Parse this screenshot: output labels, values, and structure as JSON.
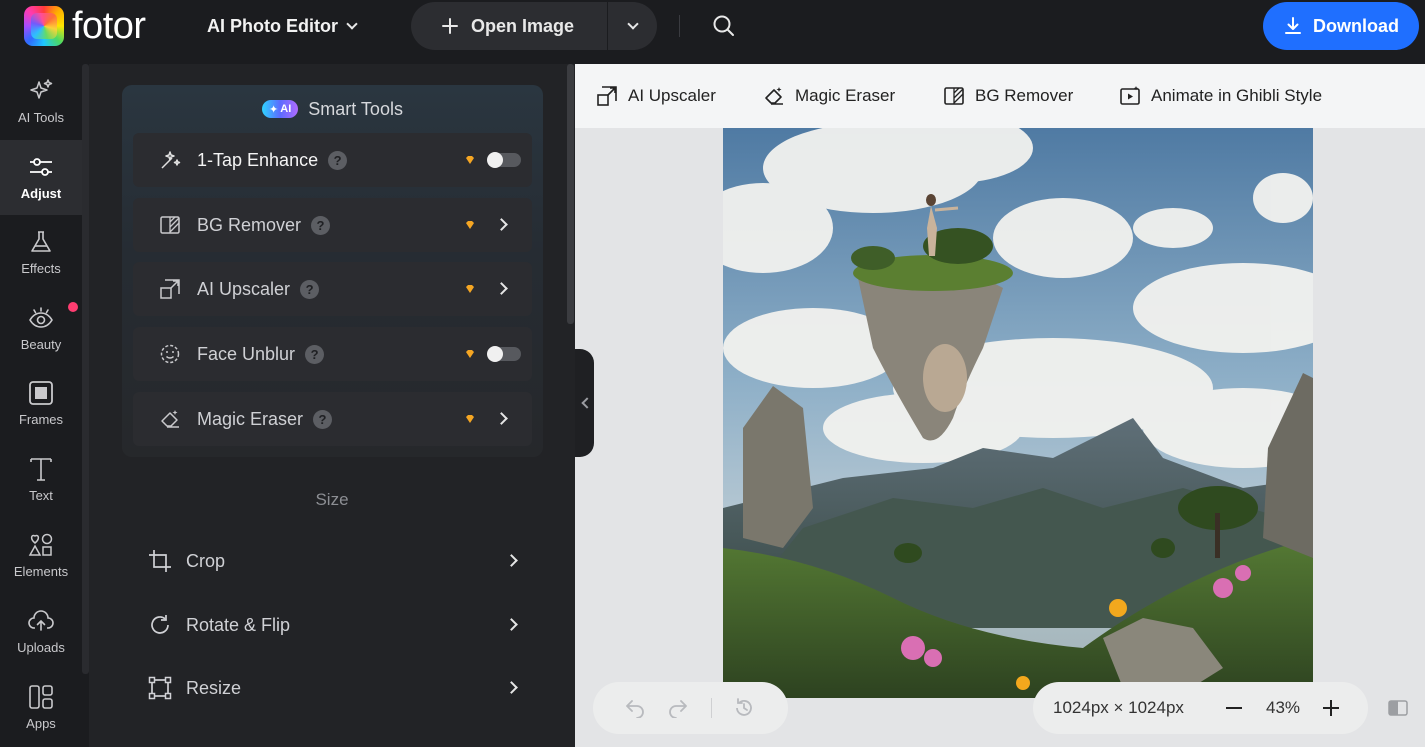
{
  "header": {
    "logo_text": "fotor",
    "editor_menu": "AI Photo Editor",
    "open_image": "Open Image",
    "download": "Download"
  },
  "rail": {
    "items": [
      {
        "label": "AI Tools",
        "icon": "sparkle-icon"
      },
      {
        "label": "Adjust",
        "icon": "sliders-icon",
        "active": true
      },
      {
        "label": "Effects",
        "icon": "flask-icon"
      },
      {
        "label": "Beauty",
        "icon": "eye-icon",
        "badge": true
      },
      {
        "label": "Frames",
        "icon": "frame-icon"
      },
      {
        "label": "Text",
        "icon": "text-icon"
      },
      {
        "label": "Elements",
        "icon": "shapes-icon"
      },
      {
        "label": "Uploads",
        "icon": "cloud-upload-icon"
      },
      {
        "label": "Apps",
        "icon": "apps-icon"
      }
    ]
  },
  "smart_tools": {
    "badge": "AI",
    "title": "Smart Tools",
    "items": [
      {
        "label": "1-Tap Enhance",
        "control": "toggle",
        "on": false
      },
      {
        "label": "BG Remover",
        "control": "arrow"
      },
      {
        "label": "AI Upscaler",
        "control": "arrow"
      },
      {
        "label": "Face Unblur",
        "control": "toggle",
        "on": false
      },
      {
        "label": "Magic Eraser",
        "control": "arrow"
      }
    ]
  },
  "size_section": {
    "title": "Size",
    "items": [
      {
        "label": "Crop"
      },
      {
        "label": "Rotate & Flip"
      },
      {
        "label": "Resize"
      }
    ]
  },
  "canvas_toolbar": {
    "items": [
      {
        "label": "AI Upscaler",
        "icon": "upscale-icon"
      },
      {
        "label": "Magic Eraser",
        "icon": "eraser-icon"
      },
      {
        "label": "BG Remover",
        "icon": "bg-remove-icon"
      },
      {
        "label": "Animate in Ghibli Style",
        "icon": "animate-icon"
      }
    ]
  },
  "canvas": {
    "image_description": "Surreal landscape: floating stone head island with a figure on top, mountains and clouds",
    "dimensions": "1024px × 1024px",
    "zoom": "43%"
  },
  "colors": {
    "accent": "#1f6fff",
    "badge_dot": "#ff3d71",
    "premium": "#f5a623"
  }
}
